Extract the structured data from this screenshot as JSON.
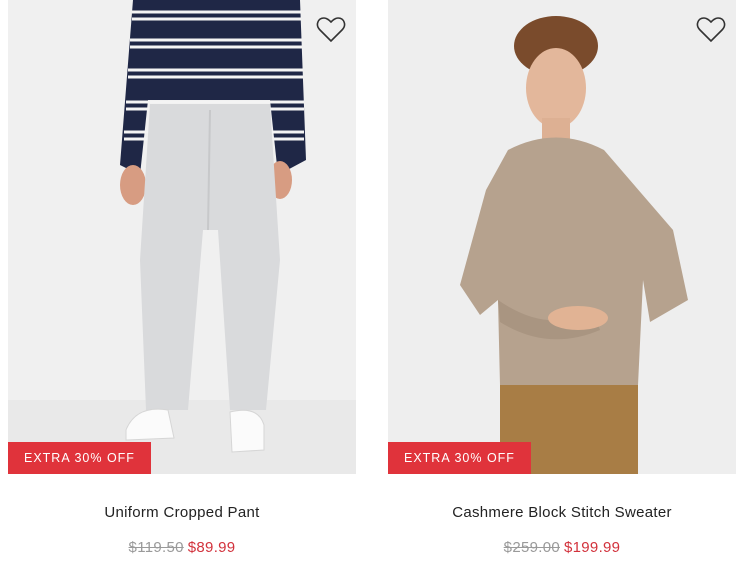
{
  "products": [
    {
      "name": "Uniform Cropped Pant",
      "badge": "EXTRA 30% OFF",
      "was_price": "$119.50",
      "sale_price": "$89.99",
      "favorite_icon": "heart-outline-icon"
    },
    {
      "name": "Cashmere Block Stitch Sweater",
      "badge": "EXTRA 30% OFF",
      "was_price": "$259.00",
      "sale_price": "$199.99",
      "favorite_icon": "heart-outline-icon"
    }
  ],
  "colors": {
    "badge_bg": "#e0333b",
    "sale_price": "#d2323c",
    "was_price": "#9a9a9a"
  }
}
